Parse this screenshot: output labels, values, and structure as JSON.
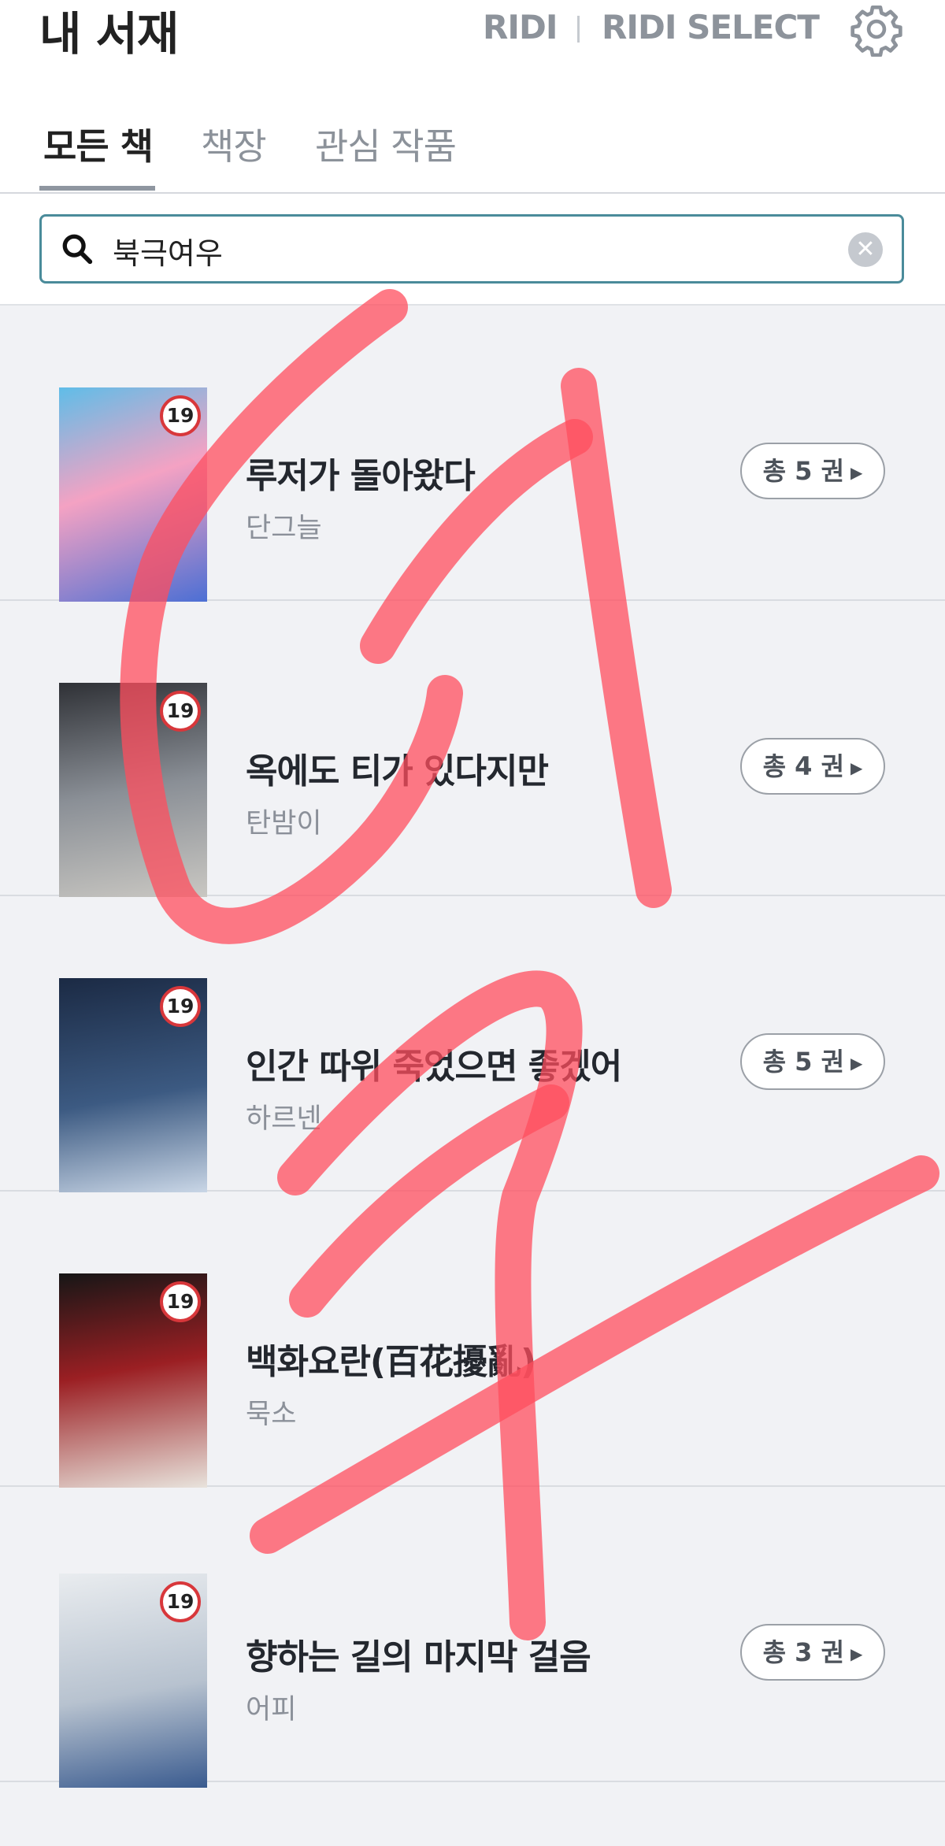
{
  "header": {
    "title": "내 서재",
    "brand_ridi": "RIDI",
    "brand_select": "RIDI SELECT",
    "settings_icon": "gear-icon"
  },
  "tabs": [
    {
      "label": "모든 책",
      "active": true
    },
    {
      "label": "책장",
      "active": false
    },
    {
      "label": "관심 작품",
      "active": false
    }
  ],
  "search": {
    "value": "북극여우",
    "icon": "search-icon",
    "clear_icon": "close-icon",
    "clear_symbol": "✕"
  },
  "books": [
    {
      "title": "루저가 돌아왔다",
      "author": "단그늘",
      "badge": "19",
      "count_label": "총 5 권",
      "cover_colors": [
        "#5fbde8",
        "#f4a2c3",
        "#4c6fd4"
      ]
    },
    {
      "title": "옥에도 티가 있다지만",
      "author": "탄밤이",
      "badge": "19",
      "count_label": "총 4 권",
      "cover_colors": [
        "#2f3136",
        "#8a8f96",
        "#c9c7c2"
      ]
    },
    {
      "title": "인간 따위 죽었으면 좋겠어",
      "author": "하르넨",
      "badge": "19",
      "count_label": "총 5 권",
      "cover_colors": [
        "#1b2a44",
        "#3c5a82",
        "#c9d6e6"
      ]
    },
    {
      "title": "백화요란(百花擾亂)",
      "author": "묵소",
      "badge": "19",
      "count_label": "",
      "cover_colors": [
        "#161616",
        "#9b1f23",
        "#e8e3dc"
      ]
    },
    {
      "title": "향하는 길의 마지막 걸음",
      "author": "어피",
      "badge": "19",
      "count_label": "총 3 권",
      "cover_colors": [
        "#e9ecef",
        "#3a5b8f",
        "#b7c2cf"
      ]
    }
  ],
  "colors": {
    "accent_border": "#4a8b9a",
    "badge_red": "#d8373b",
    "scribble": "#ff5a6a"
  }
}
